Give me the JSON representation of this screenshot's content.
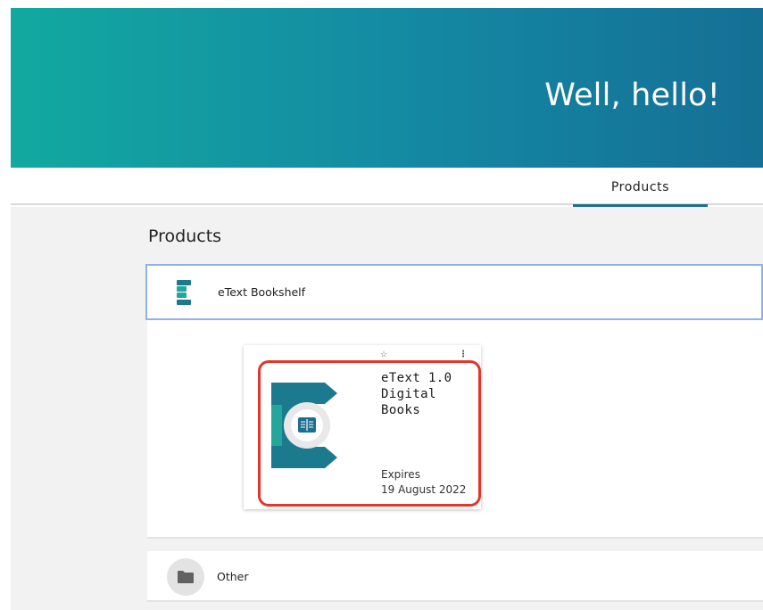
{
  "header": {
    "greeting": "Well, hello!",
    "gradient_start": "#12a9a0",
    "gradient_end": "#156f96"
  },
  "tabs": [
    {
      "label": "Products",
      "active": true
    }
  ],
  "main": {
    "section_title": "Products",
    "groups": [
      {
        "label": "eText Bookshelf",
        "icon": "etext-bookshelf-icon",
        "expanded": true,
        "products": [
          {
            "title": "eText 1.0 Digital Books",
            "icon": "etext-book-cover-icon",
            "expires_label": "Expires",
            "expires_date": "19 August 2022",
            "highlighted": true
          }
        ]
      },
      {
        "label": "Other",
        "icon": "folder-icon",
        "expanded": false
      }
    ]
  },
  "colors": {
    "accent_teal": "#1c6f8f",
    "highlight_red": "#e0362c",
    "focus_border": "#8fb2e8"
  }
}
